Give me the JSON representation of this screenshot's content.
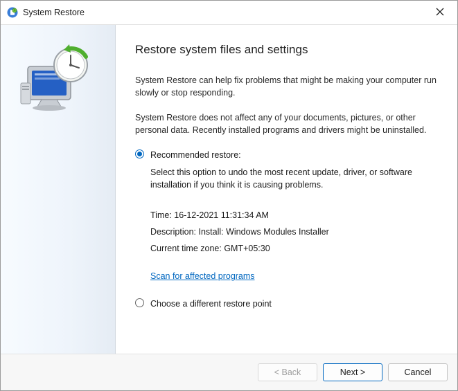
{
  "window": {
    "title": "System Restore"
  },
  "page": {
    "heading": "Restore system files and settings",
    "intro1": "System Restore can help fix problems that might be making your computer run slowly or stop responding.",
    "intro2": "System Restore does not affect any of your documents, pictures, or other personal data. Recently installed programs and drivers might be uninstalled."
  },
  "options": {
    "recommended": {
      "label": "Recommended restore:",
      "desc": "Select this option to undo the most recent update, driver, or software installation if you think it is causing problems.",
      "selected": true
    },
    "choose": {
      "label": "Choose a different restore point",
      "selected": false
    }
  },
  "details": {
    "time_label": "Time:",
    "time_value": "16-12-2021 11:31:34 AM",
    "desc_label": "Description:",
    "desc_value": "Install: Windows Modules Installer",
    "tz_label": "Current time zone:",
    "tz_value": "GMT+05:30",
    "scan_link": "Scan for affected programs"
  },
  "footer": {
    "back": "< Back",
    "next": "Next >",
    "cancel": "Cancel"
  }
}
